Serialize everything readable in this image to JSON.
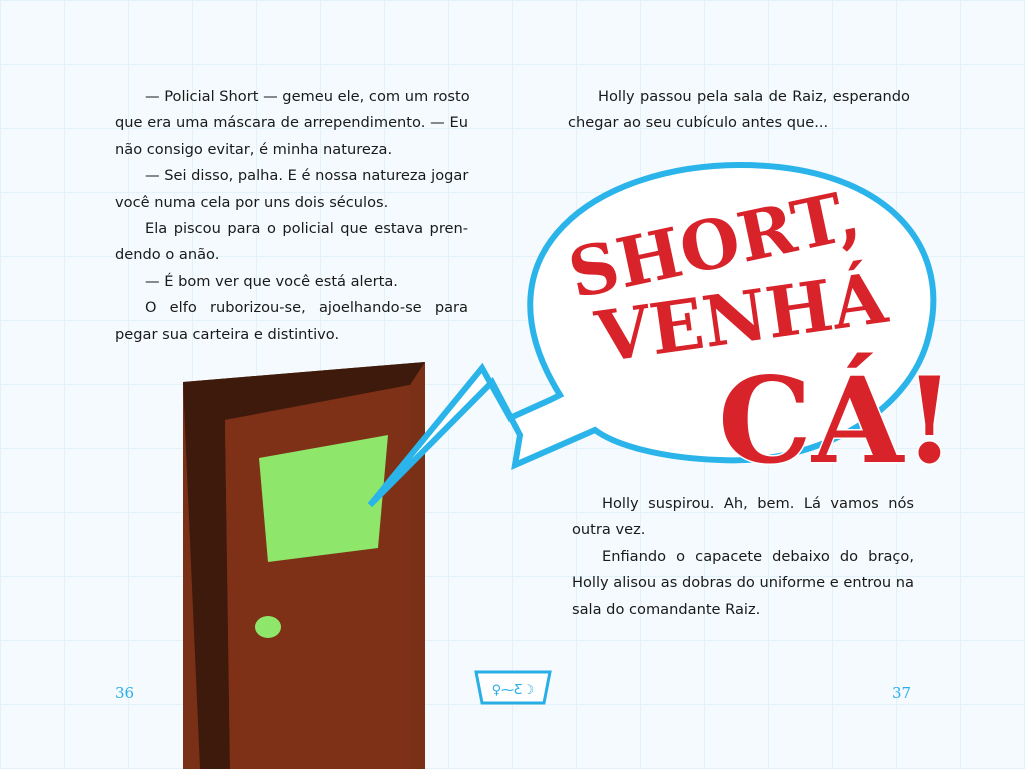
{
  "left_page": {
    "number": "36",
    "lines": [
      {
        "t": "— Policial Short — gemeu ele, com um rosto",
        "ind": true,
        "last": false
      },
      {
        "t": "que era uma máscara de arrependimento. — Eu",
        "ind": false,
        "last": false
      },
      {
        "t": "não consigo evitar, é minha natureza.",
        "ind": false,
        "last": true
      },
      {
        "t": "— Sei disso, palha. E é nossa natureza jogar",
        "ind": true,
        "last": false
      },
      {
        "t": "você numa cela por uns dois séculos.",
        "ind": false,
        "last": true
      },
      {
        "t": "Ela piscou para o policial que estava pren-",
        "ind": true,
        "last": false
      },
      {
        "t": "dendo o anão.",
        "ind": false,
        "last": true
      },
      {
        "t": "— É bom ver que você está alerta.",
        "ind": true,
        "last": true
      },
      {
        "t": "O elfo ruborizou-se, ajoelhando-se para",
        "ind": true,
        "last": false
      },
      {
        "t": "pegar sua carteira e distintivo.",
        "ind": false,
        "last": true
      }
    ]
  },
  "right_page": {
    "number": "37",
    "top_lines": [
      {
        "t": "Holly passou pela sala de Raiz, esperando",
        "ind": true,
        "last": false
      },
      {
        "t": "chegar ao seu cubículo antes que...",
        "ind": false,
        "last": true
      }
    ],
    "bottom_lines": [
      {
        "t": "Holly suspirou. Ah, bem. Lá vamos nós",
        "ind": true,
        "last": false
      },
      {
        "t": "outra vez.",
        "ind": false,
        "last": true
      },
      {
        "t": "Enfiando o capacete debaixo do braço,",
        "ind": true,
        "last": false
      },
      {
        "t": "Holly alisou as dobras do uniforme e entrou na",
        "ind": false,
        "last": false
      },
      {
        "t": "sala do comandante Raiz.",
        "ind": false,
        "last": true
      }
    ]
  },
  "speech_bubble": {
    "line1": "SHORT,",
    "line2": "VENHÁ",
    "line3": "CÁ!"
  },
  "center_emblem": {
    "glyphs": "♀⁓Ƹ☽"
  },
  "colors": {
    "accent": "#29aee6",
    "shout": "#d8232a",
    "door": "#7a3016",
    "window": "#8ee66b"
  }
}
